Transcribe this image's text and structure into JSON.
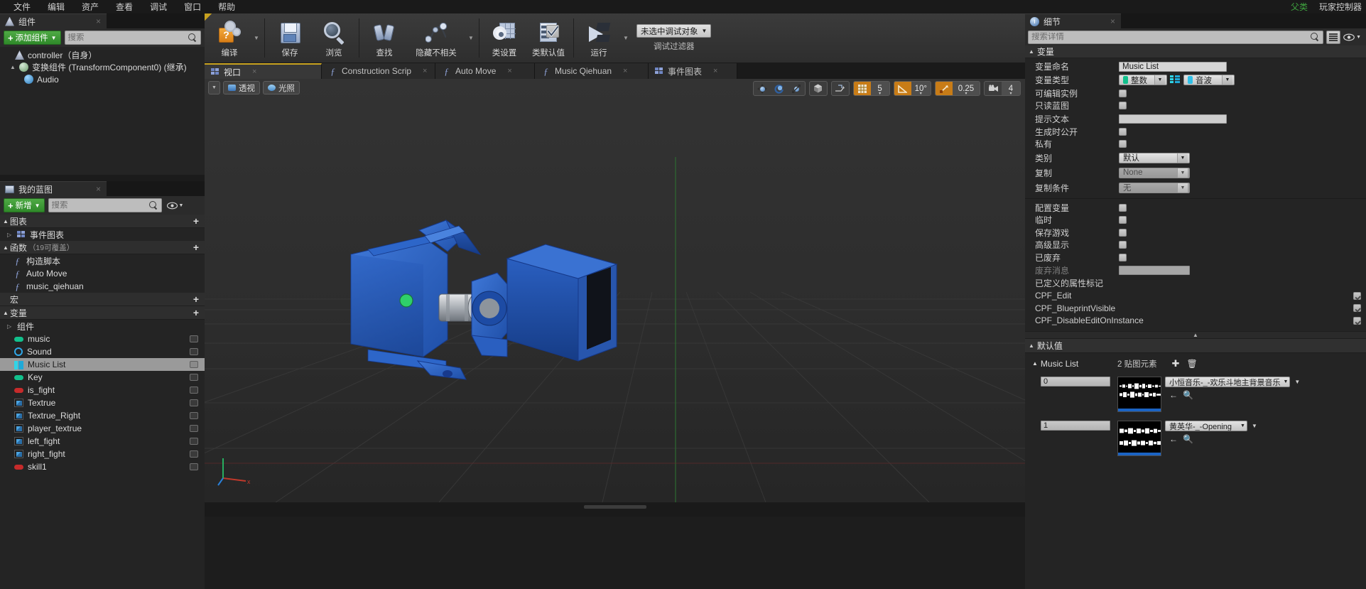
{
  "menubar": {
    "items": [
      "文件",
      "编辑",
      "资产",
      "查看",
      "调试",
      "窗口",
      "帮助"
    ],
    "right_items": [
      "父类",
      "玩家控制器"
    ]
  },
  "components_panel": {
    "tab_label": "组件",
    "add_button": "添加组件",
    "search_placeholder": "搜索",
    "tree": [
      {
        "label": "controller（自身）",
        "icon": "root-actor-icon",
        "depth": 0,
        "arrow": ""
      },
      {
        "label": "变换组件 (TransformComponent0) (继承)",
        "icon": "transform-icon",
        "depth": 1,
        "arrow": "▲"
      },
      {
        "label": "Audio",
        "icon": "audio-icon",
        "depth": 2,
        "arrow": ""
      }
    ]
  },
  "myblueprint_panel": {
    "tab_label": "我的蓝图",
    "add_button": "新增",
    "search_placeholder": "搜索",
    "sections": [
      {
        "title": "图表",
        "sub": "",
        "has_add": true,
        "items": [
          {
            "label": "事件图表",
            "icon": "graph-icon",
            "arrow": "▷"
          }
        ]
      },
      {
        "title": "函数",
        "sub": "（19可覆盖）",
        "has_add": true,
        "items": [
          {
            "label": "构造脚本",
            "icon": "construction-script-icon",
            "arrow": ""
          },
          {
            "label": "Auto Move",
            "icon": "function-icon",
            "arrow": ""
          },
          {
            "label": "music_qiehuan",
            "icon": "function-icon",
            "arrow": ""
          }
        ]
      },
      {
        "title": "宏",
        "sub": "",
        "has_add": true,
        "items": []
      },
      {
        "title": "变量",
        "sub": "",
        "has_add": true,
        "items": [
          {
            "label": "组件",
            "icon": "folder-icon",
            "arrow": "▷"
          },
          {
            "label": "music",
            "icon": "var-pill-icon",
            "color": "#12c08c",
            "selected": false
          },
          {
            "label": "Sound",
            "icon": "var-object-icon",
            "color": "#2fa7e8",
            "selected": false
          },
          {
            "label": "Music List",
            "icon": "var-array-icon",
            "color": "#2fd5e8",
            "selected": true
          },
          {
            "label": "Key",
            "icon": "var-pill-icon",
            "color": "#12c08c",
            "selected": false
          },
          {
            "label": "is_fight",
            "icon": "var-pill-icon",
            "color": "#c62b2b",
            "selected": false
          },
          {
            "label": "Textrue",
            "icon": "var-texture-icon",
            "color": "#4aa3e0",
            "selected": false
          },
          {
            "label": "Textrue_Right",
            "icon": "var-texture-icon",
            "color": "#4aa3e0",
            "selected": false
          },
          {
            "label": "player_textrue",
            "icon": "var-texture-icon",
            "color": "#4aa3e0",
            "selected": false
          },
          {
            "label": "left_fight",
            "icon": "var-texture-icon",
            "color": "#4aa3e0",
            "selected": false
          },
          {
            "label": "right_fight",
            "icon": "var-texture-icon",
            "color": "#4aa3e0",
            "selected": false
          },
          {
            "label": "skill1",
            "icon": "var-pill-icon",
            "color": "#c62b2b",
            "selected": false
          }
        ]
      }
    ]
  },
  "toolbar": {
    "buttons": [
      {
        "label": "编译",
        "icon": "compile-icon",
        "caret": true
      },
      {
        "label": "保存",
        "icon": "save-icon",
        "caret": false
      },
      {
        "label": "浏览",
        "icon": "browse-icon",
        "caret": false
      },
      {
        "label": "查找",
        "icon": "find-icon",
        "caret": false
      },
      {
        "label": "隐藏不相关",
        "icon": "hide-unrelated-icon",
        "caret": true
      },
      {
        "label": "类设置",
        "icon": "class-settings-icon",
        "caret": false
      },
      {
        "label": "类默认值",
        "icon": "class-defaults-icon",
        "caret": false
      },
      {
        "label": "运行",
        "icon": "run-icon",
        "caret": true
      }
    ],
    "debug_object": "未选中调试对象",
    "debug_filter_label": "调试过滤器"
  },
  "doc_tabs": [
    {
      "label": "视口",
      "icon": "viewport-icon",
      "active": true,
      "closable": true
    },
    {
      "label": "Construction Scrip",
      "icon": "function-icon",
      "active": false,
      "closable": true
    },
    {
      "label": "Auto Move",
      "icon": "function-icon",
      "active": false,
      "closable": true
    },
    {
      "label": "Music Qiehuan",
      "icon": "function-icon",
      "active": false,
      "closable": true
    },
    {
      "label": "事件图表",
      "icon": "graph-icon",
      "active": false,
      "closable": true
    }
  ],
  "viewport": {
    "left_buttons": [
      {
        "label": "透视",
        "icon": "perspective-icon"
      },
      {
        "label": "光照",
        "icon": "lighting-icon"
      }
    ],
    "grid_snap": "5",
    "angle_snap": "10°",
    "scale_snap": "0.25",
    "camera_speed": "4"
  },
  "details": {
    "tab_label": "细节",
    "search_placeholder": "搜索详情",
    "variable_section": {
      "title": "变量",
      "rows": [
        {
          "label": "变量命名",
          "type": "text",
          "value": "Music List"
        },
        {
          "label": "变量类型",
          "type": "type",
          "value": "整数",
          "secondary": "音波"
        },
        {
          "label": "可编辑实例",
          "type": "check",
          "checked": false
        },
        {
          "label": "只读蓝图",
          "type": "check",
          "checked": false
        },
        {
          "label": "提示文本",
          "type": "textwide",
          "value": ""
        },
        {
          "label": "生成时公开",
          "type": "check",
          "checked": false
        },
        {
          "label": "私有",
          "type": "check",
          "checked": false
        },
        {
          "label": "类别",
          "type": "combo",
          "value": "默认"
        },
        {
          "label": "复制",
          "type": "combo-dim",
          "value": "None"
        },
        {
          "label": "复制条件",
          "type": "combo-dim",
          "value": "无"
        }
      ],
      "rows2": [
        {
          "label": "配置变量",
          "type": "check",
          "checked": false
        },
        {
          "label": "临时",
          "type": "check",
          "checked": false
        },
        {
          "label": "保存游戏",
          "type": "check",
          "checked": false
        },
        {
          "label": "高级显示",
          "type": "check",
          "checked": false
        },
        {
          "label": "已废弃",
          "type": "check",
          "checked": false
        },
        {
          "label": "废弃消息",
          "type": "textwide-dim",
          "value": ""
        },
        {
          "label": "已定义的属性标记",
          "type": "label"
        },
        {
          "label": "CPF_Edit",
          "type": "check-right",
          "checked": true
        },
        {
          "label": "CPF_BlueprintVisible",
          "type": "check-right",
          "checked": true
        },
        {
          "label": "CPF_DisableEditOnInstance",
          "type": "check-right",
          "checked": true
        }
      ]
    },
    "default_section": {
      "title": "默认值",
      "array_name": "Music List",
      "array_count_label": "2 贴图元素",
      "add_icon": "plus-icon",
      "delete_icon": "trash-icon",
      "items": [
        {
          "index": "0",
          "asset": "小恒音乐-_-欢乐斗地主背景音乐",
          "thumb": "audio-waveform"
        },
        {
          "index": "1",
          "asset": "黄英华-_-Opening",
          "thumb": "audio-waveform"
        }
      ]
    }
  },
  "colors": {
    "accent_orange": "#c8a21f",
    "green_button": "#3f9a35",
    "selection": "#9a9a9a",
    "panel_bg": "#242424",
    "viewport_bg": "#2b2b2b",
    "model_blue": "#2a5fc0"
  }
}
